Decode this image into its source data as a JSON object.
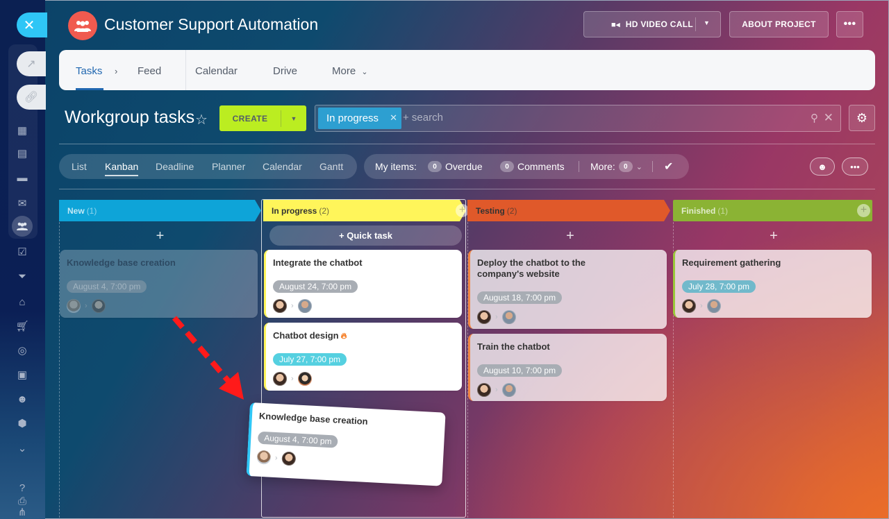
{
  "app": {
    "title": "Customer Support Automation",
    "logo_icon": "group-icon"
  },
  "header": {
    "video_call_label": "HD VIDEO CALL",
    "about_label": "ABOUT PROJECT",
    "more_icon": "ellipsis-icon"
  },
  "nav": {
    "items": [
      {
        "label": "Tasks",
        "active": true
      },
      {
        "label": "Feed"
      },
      {
        "label": "Calendar"
      },
      {
        "label": "Drive"
      },
      {
        "label": "More"
      }
    ]
  },
  "toolbar": {
    "page_title": "Workgroup tasks",
    "create_label": "CREATE",
    "filter_chip": "In progress",
    "search_placeholder": "+ search"
  },
  "views": {
    "items": [
      "List",
      "Kanban",
      "Deadline",
      "Planner",
      "Calendar",
      "Gantt"
    ],
    "active": "Kanban"
  },
  "counters": {
    "my_items_label": "My items:",
    "overdue_count": "0",
    "overdue_label": "Overdue",
    "comments_count": "0",
    "comments_label": "Comments",
    "more_label": "More:",
    "more_count": "0"
  },
  "columns": [
    {
      "name": "New",
      "count": "(1)",
      "color": "#0ea4d8"
    },
    {
      "name": "In progress",
      "count": "(2)",
      "color": "#fff55a",
      "quick_task_label": "+ Quick task"
    },
    {
      "name": "Testing",
      "count": "(2)",
      "color": "#e0592a"
    },
    {
      "name": "Finished",
      "count": "(1)",
      "color": "#8bb334"
    }
  ],
  "cards": {
    "new_ghost": {
      "title": "Knowledge base creation",
      "deadline": "August 4, 7:00 pm"
    },
    "integrate": {
      "title": "Integrate the chatbot",
      "deadline": "August 24, 7:00 pm"
    },
    "design": {
      "title": "Chatbot design",
      "deadline": "July 27, 7:00 pm",
      "hot": true
    },
    "deploy": {
      "title": "Deploy the chatbot to the company's website",
      "deadline": "August 18, 7:00 pm"
    },
    "train": {
      "title": "Train the chatbot",
      "deadline": "August 10, 7:00 pm"
    },
    "requirements": {
      "title": "Requirement gathering",
      "deadline": "July 28, 7:00 pm"
    },
    "dragging": {
      "title": "Knowledge base creation",
      "deadline": "August 4, 7:00 pm"
    }
  },
  "colors": {
    "accent_blue": "#2067b0",
    "create_green": "#bbed21",
    "chip_blue": "#2d9fd1",
    "drag_arrow_red": "#ff1a1a"
  }
}
